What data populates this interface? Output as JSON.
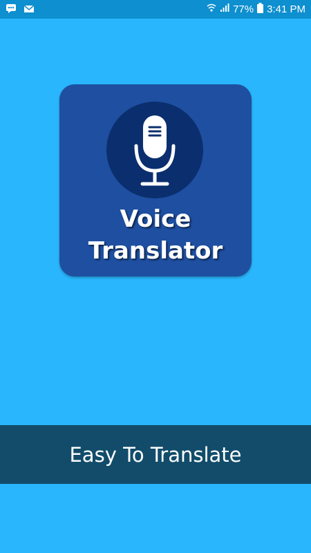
{
  "status_bar": {
    "battery_percent": "77%",
    "time": "3:41 PM",
    "icons": [
      "chat-notification-icon",
      "email-icon",
      "wifi-icon",
      "signal-icon",
      "battery-icon"
    ]
  },
  "logo": {
    "icon": "microphone-icon",
    "title_line1": "Voice",
    "title_line2": "Translator"
  },
  "banner": {
    "text": "Easy To Translate"
  },
  "colors": {
    "background": "#29b6fc",
    "status_bar": "#0d8fd0",
    "logo_card": "#1e4fa1",
    "mic_circle": "#0b2f6e",
    "banner": "#124c6a"
  }
}
